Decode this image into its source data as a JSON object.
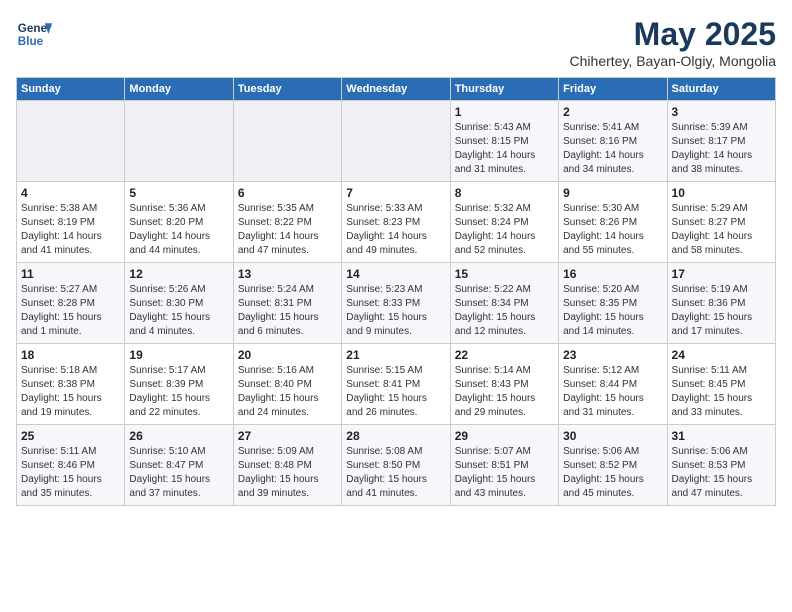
{
  "header": {
    "logo_line1": "General",
    "logo_line2": "Blue",
    "month": "May 2025",
    "location": "Chihertey, Bayan-Olgiy, Mongolia"
  },
  "weekdays": [
    "Sunday",
    "Monday",
    "Tuesday",
    "Wednesday",
    "Thursday",
    "Friday",
    "Saturday"
  ],
  "weeks": [
    [
      {
        "day": "",
        "detail": ""
      },
      {
        "day": "",
        "detail": ""
      },
      {
        "day": "",
        "detail": ""
      },
      {
        "day": "",
        "detail": ""
      },
      {
        "day": "1",
        "detail": "Sunrise: 5:43 AM\nSunset: 8:15 PM\nDaylight: 14 hours\nand 31 minutes."
      },
      {
        "day": "2",
        "detail": "Sunrise: 5:41 AM\nSunset: 8:16 PM\nDaylight: 14 hours\nand 34 minutes."
      },
      {
        "day": "3",
        "detail": "Sunrise: 5:39 AM\nSunset: 8:17 PM\nDaylight: 14 hours\nand 38 minutes."
      }
    ],
    [
      {
        "day": "4",
        "detail": "Sunrise: 5:38 AM\nSunset: 8:19 PM\nDaylight: 14 hours\nand 41 minutes."
      },
      {
        "day": "5",
        "detail": "Sunrise: 5:36 AM\nSunset: 8:20 PM\nDaylight: 14 hours\nand 44 minutes."
      },
      {
        "day": "6",
        "detail": "Sunrise: 5:35 AM\nSunset: 8:22 PM\nDaylight: 14 hours\nand 47 minutes."
      },
      {
        "day": "7",
        "detail": "Sunrise: 5:33 AM\nSunset: 8:23 PM\nDaylight: 14 hours\nand 49 minutes."
      },
      {
        "day": "8",
        "detail": "Sunrise: 5:32 AM\nSunset: 8:24 PM\nDaylight: 14 hours\nand 52 minutes."
      },
      {
        "day": "9",
        "detail": "Sunrise: 5:30 AM\nSunset: 8:26 PM\nDaylight: 14 hours\nand 55 minutes."
      },
      {
        "day": "10",
        "detail": "Sunrise: 5:29 AM\nSunset: 8:27 PM\nDaylight: 14 hours\nand 58 minutes."
      }
    ],
    [
      {
        "day": "11",
        "detail": "Sunrise: 5:27 AM\nSunset: 8:28 PM\nDaylight: 15 hours\nand 1 minute."
      },
      {
        "day": "12",
        "detail": "Sunrise: 5:26 AM\nSunset: 8:30 PM\nDaylight: 15 hours\nand 4 minutes."
      },
      {
        "day": "13",
        "detail": "Sunrise: 5:24 AM\nSunset: 8:31 PM\nDaylight: 15 hours\nand 6 minutes."
      },
      {
        "day": "14",
        "detail": "Sunrise: 5:23 AM\nSunset: 8:33 PM\nDaylight: 15 hours\nand 9 minutes."
      },
      {
        "day": "15",
        "detail": "Sunrise: 5:22 AM\nSunset: 8:34 PM\nDaylight: 15 hours\nand 12 minutes."
      },
      {
        "day": "16",
        "detail": "Sunrise: 5:20 AM\nSunset: 8:35 PM\nDaylight: 15 hours\nand 14 minutes."
      },
      {
        "day": "17",
        "detail": "Sunrise: 5:19 AM\nSunset: 8:36 PM\nDaylight: 15 hours\nand 17 minutes."
      }
    ],
    [
      {
        "day": "18",
        "detail": "Sunrise: 5:18 AM\nSunset: 8:38 PM\nDaylight: 15 hours\nand 19 minutes."
      },
      {
        "day": "19",
        "detail": "Sunrise: 5:17 AM\nSunset: 8:39 PM\nDaylight: 15 hours\nand 22 minutes."
      },
      {
        "day": "20",
        "detail": "Sunrise: 5:16 AM\nSunset: 8:40 PM\nDaylight: 15 hours\nand 24 minutes."
      },
      {
        "day": "21",
        "detail": "Sunrise: 5:15 AM\nSunset: 8:41 PM\nDaylight: 15 hours\nand 26 minutes."
      },
      {
        "day": "22",
        "detail": "Sunrise: 5:14 AM\nSunset: 8:43 PM\nDaylight: 15 hours\nand 29 minutes."
      },
      {
        "day": "23",
        "detail": "Sunrise: 5:12 AM\nSunset: 8:44 PM\nDaylight: 15 hours\nand 31 minutes."
      },
      {
        "day": "24",
        "detail": "Sunrise: 5:11 AM\nSunset: 8:45 PM\nDaylight: 15 hours\nand 33 minutes."
      }
    ],
    [
      {
        "day": "25",
        "detail": "Sunrise: 5:11 AM\nSunset: 8:46 PM\nDaylight: 15 hours\nand 35 minutes."
      },
      {
        "day": "26",
        "detail": "Sunrise: 5:10 AM\nSunset: 8:47 PM\nDaylight: 15 hours\nand 37 minutes."
      },
      {
        "day": "27",
        "detail": "Sunrise: 5:09 AM\nSunset: 8:48 PM\nDaylight: 15 hours\nand 39 minutes."
      },
      {
        "day": "28",
        "detail": "Sunrise: 5:08 AM\nSunset: 8:50 PM\nDaylight: 15 hours\nand 41 minutes."
      },
      {
        "day": "29",
        "detail": "Sunrise: 5:07 AM\nSunset: 8:51 PM\nDaylight: 15 hours\nand 43 minutes."
      },
      {
        "day": "30",
        "detail": "Sunrise: 5:06 AM\nSunset: 8:52 PM\nDaylight: 15 hours\nand 45 minutes."
      },
      {
        "day": "31",
        "detail": "Sunrise: 5:06 AM\nSunset: 8:53 PM\nDaylight: 15 hours\nand 47 minutes."
      }
    ]
  ]
}
